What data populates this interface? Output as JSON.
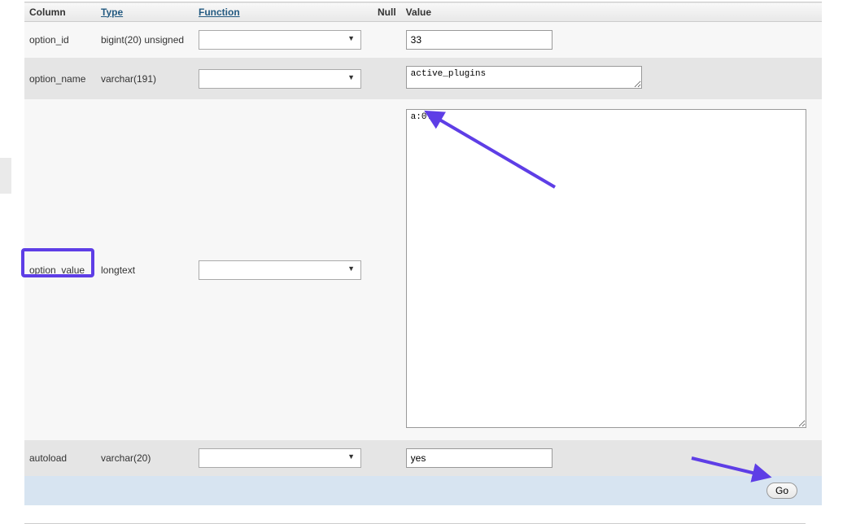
{
  "headers": {
    "column": "Column",
    "type": "Type",
    "function": "Function",
    "null": "Null",
    "value": "Value"
  },
  "rows": [
    {
      "column": "option_id",
      "type": "bigint(20) unsigned",
      "value": "33"
    },
    {
      "column": "option_name",
      "type": "varchar(191)",
      "value": "active_plugins"
    },
    {
      "column": "option_value",
      "type": "longtext",
      "value": "a:0:{}"
    },
    {
      "column": "autoload",
      "type": "varchar(20)",
      "value": "yes"
    }
  ],
  "buttons": {
    "go": "Go"
  },
  "chart_data": null
}
